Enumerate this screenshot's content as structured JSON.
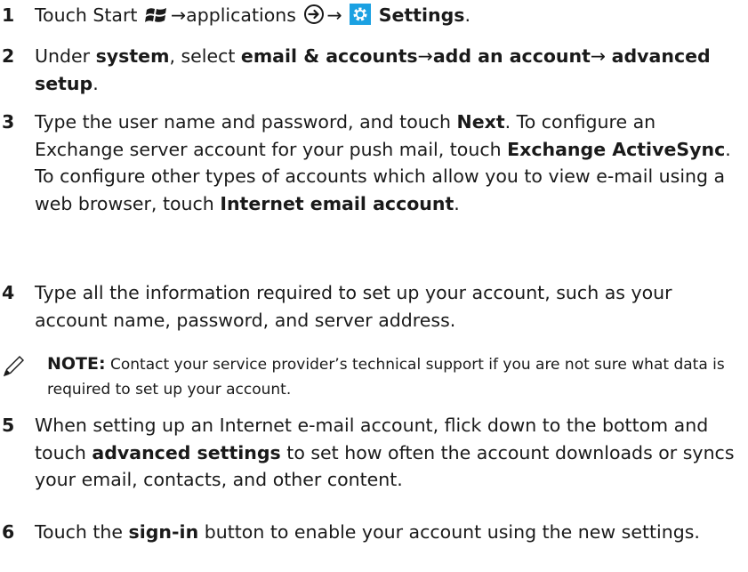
{
  "steps": [
    {
      "number": "1",
      "t1": "Touch Start",
      "t2": "→applications",
      "t3": "→",
      "b1": "Settings",
      "t4": "."
    },
    {
      "number": "2",
      "t1": "Under",
      "b1": "system",
      "t2": ", select",
      "b2": "email & accounts",
      "t3": "→",
      "b3": "add an account",
      "t4": "→",
      "b4": "advanced setup",
      "t5": "."
    },
    {
      "number": "3",
      "t1": "Type the user name and password, and touch",
      "b1": "Next",
      "t2": ". To configure an Exchange server account for your push mail, touch",
      "b2": "Exchange ActiveSync",
      "t3": ". To configure other types of accounts which allow you to view e-mail using a web browser, touch",
      "b3": "Internet email account",
      "t4": "."
    },
    {
      "number": "4",
      "t1": "Type all the information required to set up your account, such as your account name, password, and server address."
    },
    {
      "number": "5",
      "t1": "When setting up an Internet e-mail account, flick down to the bottom and touch",
      "b1": "advanced settings",
      "t2": "to set how often the account downloads or syncs your email, contacts, and other content."
    },
    {
      "number": "6",
      "t1": "Touch the",
      "b1": "sign-in",
      "t2": "button to enable your account using the new settings."
    }
  ],
  "note": {
    "label": "NOTE:",
    "text": "Contact your service provider’s technical support if you are not sure what data is required to set up your account."
  },
  "icons": {
    "start": "windows-logo-icon",
    "applications": "circled-arrow-right-icon",
    "settings": "gear-icon",
    "note": "pencil-note-icon"
  },
  "colors": {
    "text": "#1a1a1a",
    "settings_icon_bg": "#1ba1e2"
  }
}
